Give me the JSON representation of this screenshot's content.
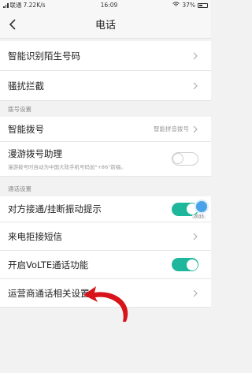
{
  "status_bar": {
    "carrier": "联通",
    "speed": "7.22K/s",
    "time": "16:09",
    "battery": "37%"
  },
  "header": {
    "title": "电话"
  },
  "rows": {
    "smart_id": {
      "label": "智能识别陌生号码"
    },
    "harass": {
      "label": "骚扰拦截"
    },
    "smart_dial": {
      "label": "智能拨号",
      "value": "智能拼音拨号"
    },
    "roaming": {
      "label": "漫游拨号助理",
      "sublabel": "漫游拨号时自动为中国大陆手机号码加\"+86\"前缀。",
      "toggle": false
    },
    "vibrate": {
      "label": "对方接通/挂断振动提示",
      "toggle": true
    },
    "reject_sms": {
      "label": "来电拒接短信"
    },
    "volte": {
      "label": "开启VoLTE通话功能",
      "toggle": true
    },
    "carrier_settings": {
      "label": "运营商通话相关设置"
    }
  },
  "sections": {
    "dial": "拨号设置",
    "call": "通话设置"
  },
  "touch_indicator": {
    "label": "2033"
  },
  "colors": {
    "toggle_on": "#1fb79b",
    "annotation_arrow": "#d7141a"
  }
}
